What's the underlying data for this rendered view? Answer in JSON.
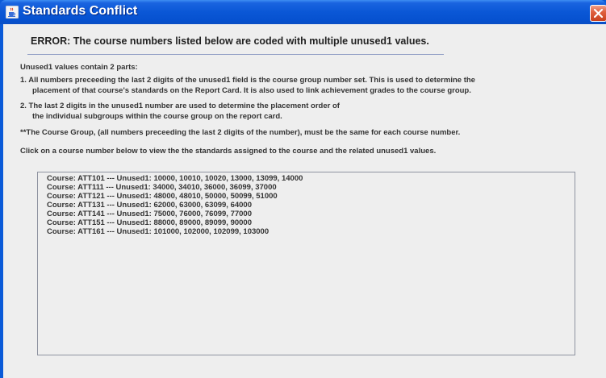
{
  "window": {
    "title": "Standards Conflict"
  },
  "dialog": {
    "error_heading": "ERROR:  The course numbers listed below are coded with multiple unused1 values.",
    "intro": "Unused1 values contain 2 parts:",
    "point1_line1": "1. All numbers preceeding the last 2 digits of the unused1 field is the course group number set.  This is used to determine the",
    "point1_line2": "placement of that course's standards on the Report Card.  It is also used to link achievement grades to the course group.",
    "point2_line1": "2. The last 2 digits in the unused1 number are used to determine the placement order of",
    "point2_line2": "the individual subgroups within the course group on the report card.",
    "note": "**The Course Group, (all numbers preceeding the last 2 digits of the number), must be the same for each course number.",
    "instruction": "Click on a course number below to view the the standards assigned to the course and the related unused1 values."
  },
  "courses": [
    {
      "text": "Course: ATT101  ---  Unused1: 10000, 10010, 10020, 13000, 13099, 14000"
    },
    {
      "text": "Course: ATT111  ---  Unused1: 34000, 34010, 36000, 36099, 37000"
    },
    {
      "text": "Course: ATT121  ---  Unused1: 48000, 48010, 50000, 50099, 51000"
    },
    {
      "text": "Course: ATT131  ---  Unused1: 62000, 63000, 63099, 64000"
    },
    {
      "text": "Course: ATT141  ---  Unused1: 75000, 76000, 76099, 77000"
    },
    {
      "text": "Course: ATT151  ---  Unused1: 88000, 89000, 89099, 90000"
    },
    {
      "text": "Course: ATT161  ---  Unused1: 101000, 102000, 102099, 103000"
    }
  ],
  "icons": {
    "app": "java-cup-icon",
    "close": "close-x-icon"
  },
  "colors": {
    "titlebar": "#0a57d6",
    "close_button": "#e0603f",
    "content_background": "#eeeeee"
  }
}
